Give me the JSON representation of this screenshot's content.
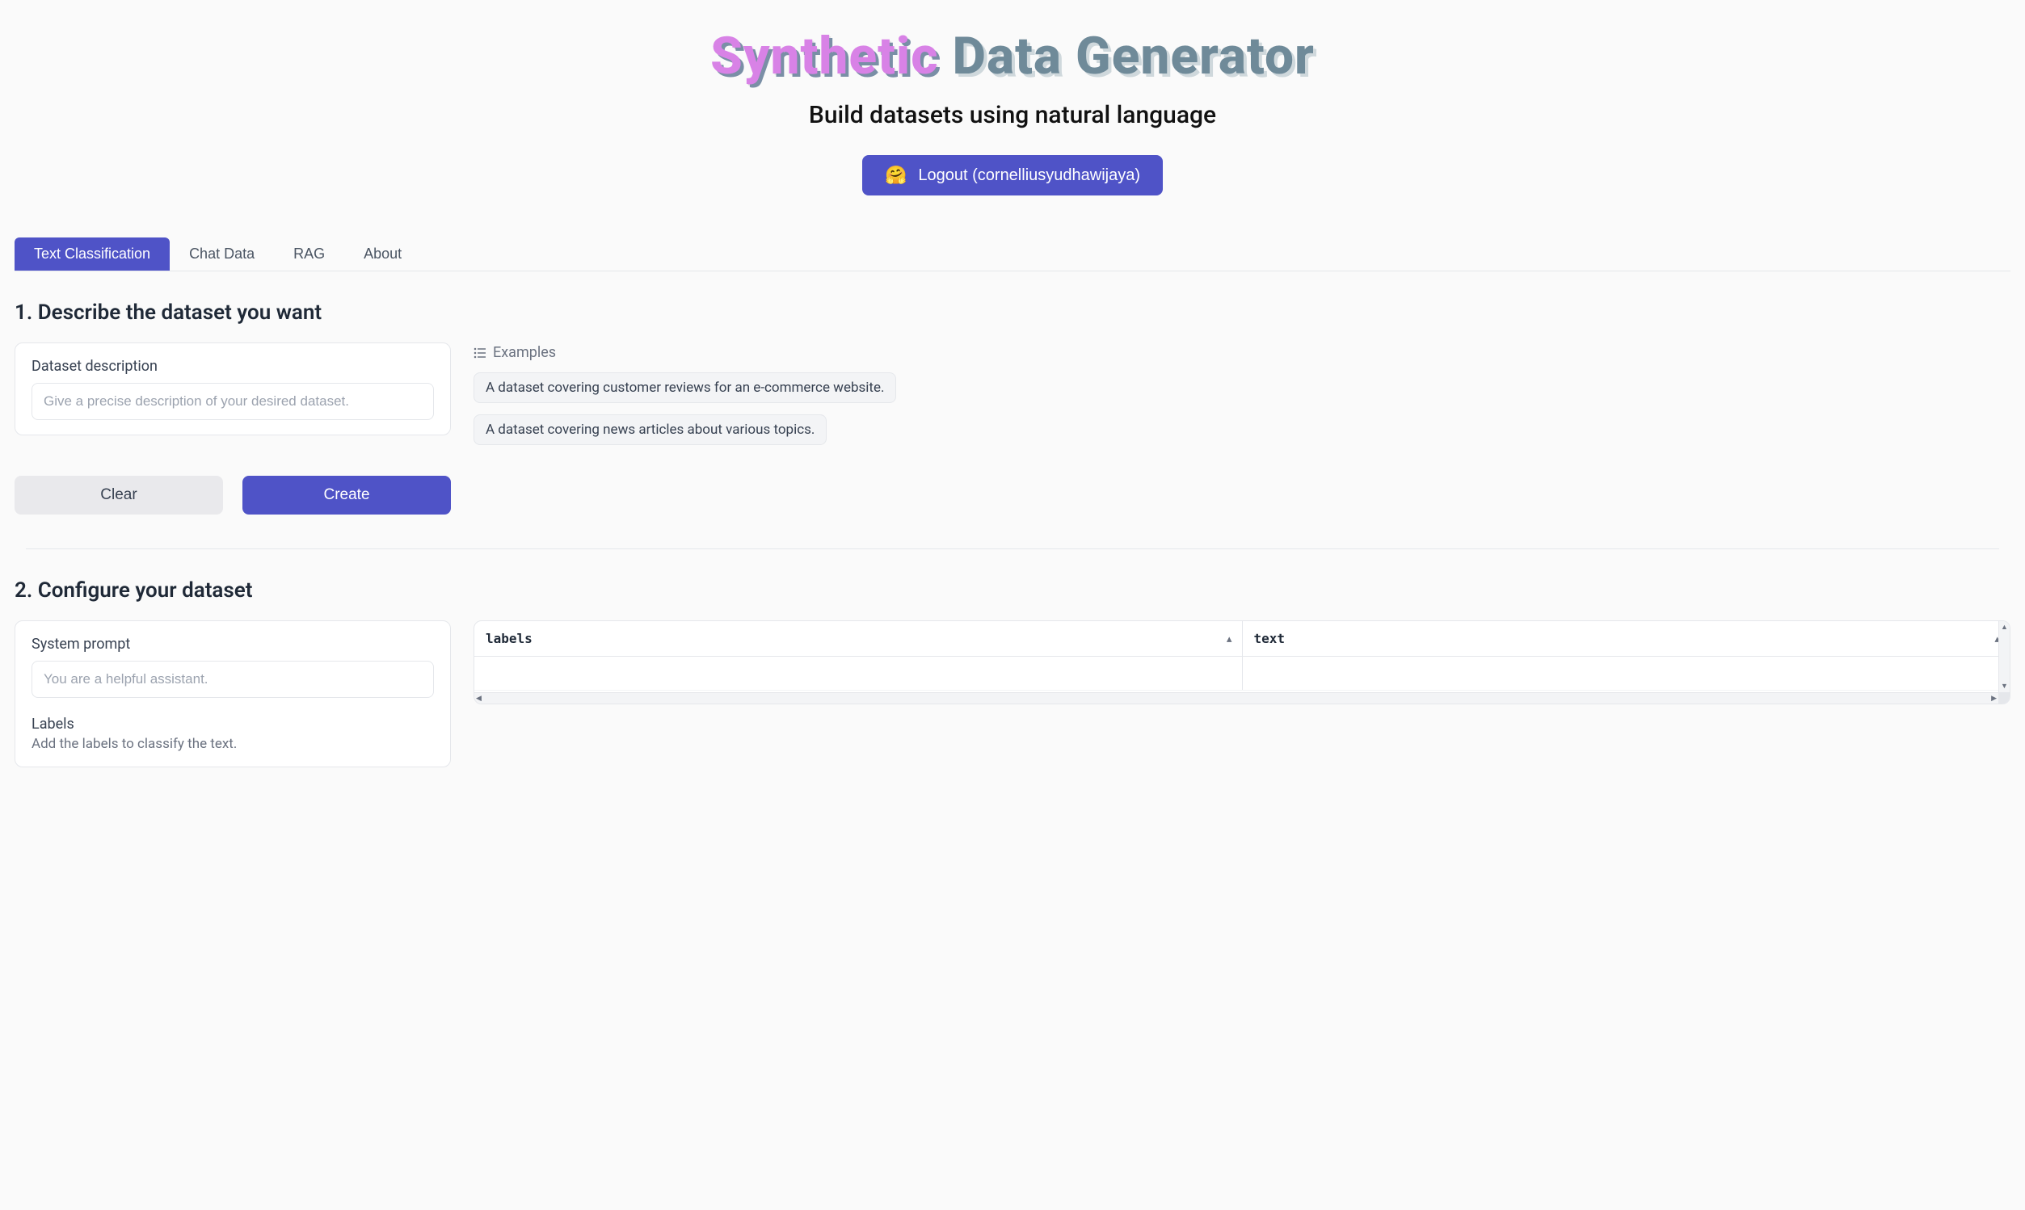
{
  "header": {
    "title_word1": "Synthetic",
    "title_rest": "Data Generator",
    "subtitle": "Build datasets using natural language",
    "logout_label": "Logout (cornelliusyudhawijaya)"
  },
  "tabs": {
    "items": [
      {
        "label": "Text Classification",
        "active": true
      },
      {
        "label": "Chat Data",
        "active": false
      },
      {
        "label": "RAG",
        "active": false
      },
      {
        "label": "About",
        "active": false
      }
    ]
  },
  "section1": {
    "heading": "1. Describe the dataset you want",
    "description_label": "Dataset description",
    "description_placeholder": "Give a precise description of your desired dataset.",
    "examples_label": "Examples",
    "examples": [
      "A dataset covering customer reviews for an e-commerce website.",
      "A dataset covering news articles about various topics."
    ],
    "clear_label": "Clear",
    "create_label": "Create"
  },
  "section2": {
    "heading": "2. Configure your dataset",
    "system_prompt_label": "System prompt",
    "system_prompt_placeholder": "You are a helpful assistant.",
    "labels_label": "Labels",
    "labels_sublabel": "Add the labels to classify the text.",
    "table": {
      "columns": [
        "labels",
        "text"
      ]
    }
  }
}
